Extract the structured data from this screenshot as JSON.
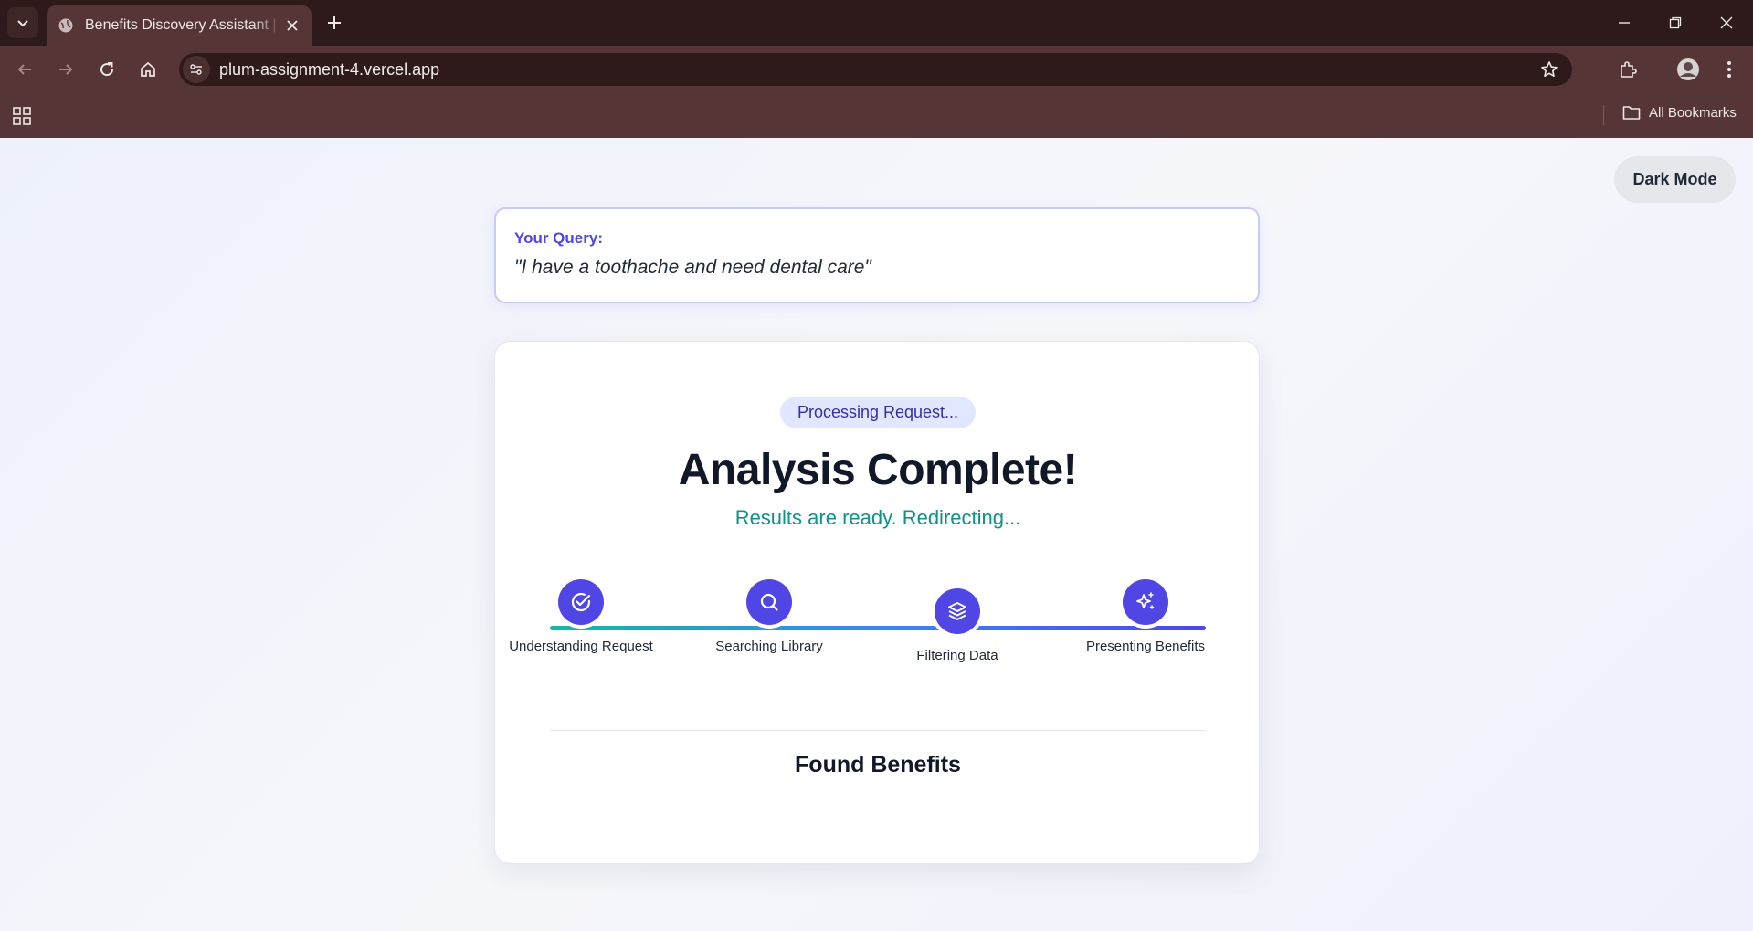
{
  "browser": {
    "tab_title": "Benefits Discovery Assistant | AI",
    "url": "plum-assignment-4.vercel.app",
    "bookmarks_label": "All Bookmarks",
    "icons": [
      "tab-search-icon",
      "globe-icon",
      "close-icon",
      "plus-icon",
      "minimize-icon",
      "restore-icon",
      "window-close-icon",
      "back-icon",
      "forward-icon",
      "reload-icon",
      "home-icon",
      "site-info-icon",
      "star-icon",
      "extensions-icon",
      "profile-icon",
      "menu-icon",
      "apps-icon",
      "folder-icon"
    ]
  },
  "header": {
    "theme_toggle_label": "Dark Mode"
  },
  "query": {
    "label": "Your Query:",
    "text": "\"I have a toothache and need dental care\""
  },
  "status": {
    "badge": "Processing Request...",
    "headline": "Analysis Complete!",
    "subline": "Results are ready. Redirecting..."
  },
  "steps": [
    {
      "label": "Understanding Request",
      "icon": "check-circle-icon"
    },
    {
      "label": "Searching Library",
      "icon": "search-icon"
    },
    {
      "label": "Filtering Data",
      "icon": "layers-icon"
    },
    {
      "label": "Presenting Benefits",
      "icon": "sparkles-icon"
    }
  ],
  "results": {
    "title": "Found Benefits"
  },
  "colors": {
    "primary": "#4f46e5",
    "accent_teal": "#0d9488",
    "chrome": "#553535"
  }
}
